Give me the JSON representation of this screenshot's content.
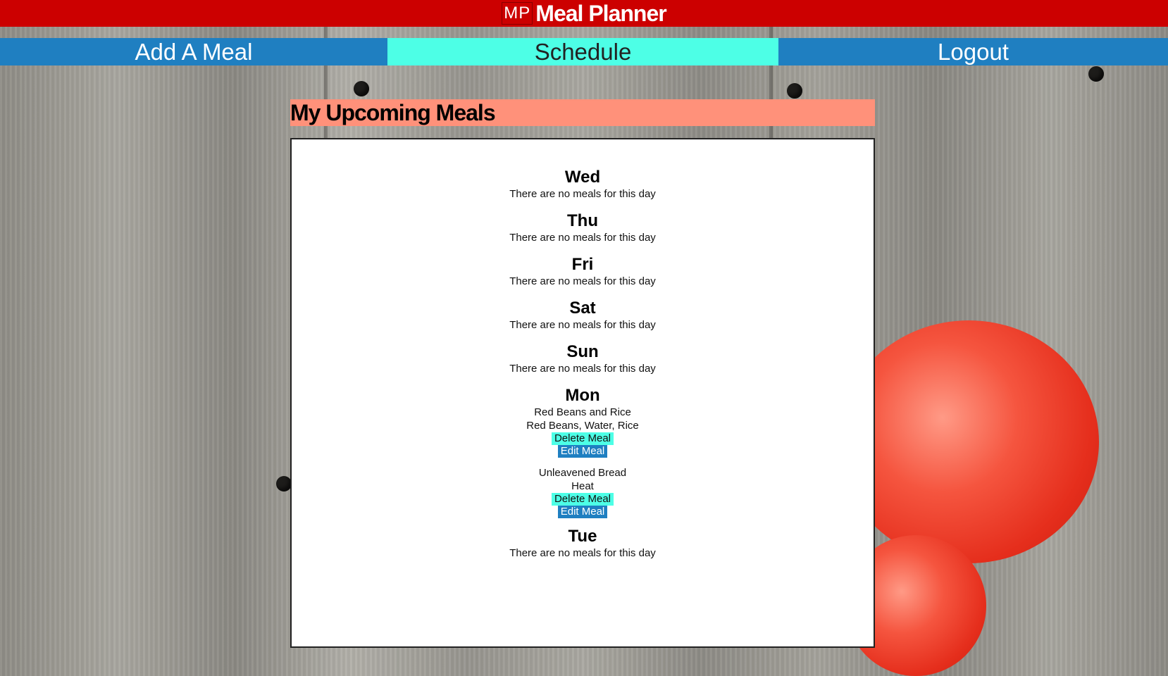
{
  "app": {
    "logo": "MP",
    "title": "Meal Planner"
  },
  "nav": {
    "add_meal": "Add A Meal",
    "schedule": "Schedule",
    "logout": "Logout"
  },
  "page": {
    "heading": "My Upcoming Meals"
  },
  "empty_text": "There are no meals for this day",
  "days": [
    {
      "name": "Wed"
    },
    {
      "name": "Thu"
    },
    {
      "name": "Fri"
    },
    {
      "name": "Sat"
    },
    {
      "name": "Sun"
    },
    {
      "name": "Mon",
      "meals": [
        {
          "name": "Red Beans and Rice",
          "ingredients": "Red Beans, Water, Rice",
          "delete_label": "Delete Meal",
          "edit_label": "Edit Meal"
        },
        {
          "name": "Unleavened Bread",
          "ingredients": "Heat",
          "delete_label": "Delete Meal",
          "edit_label": "Edit Meal"
        }
      ]
    },
    {
      "name": "Tue"
    }
  ],
  "colors": {
    "topbar": "#cc0000",
    "nav": "#1f7fc1",
    "nav_active": "#4dffe6",
    "heading_bg": "#ff917a"
  }
}
